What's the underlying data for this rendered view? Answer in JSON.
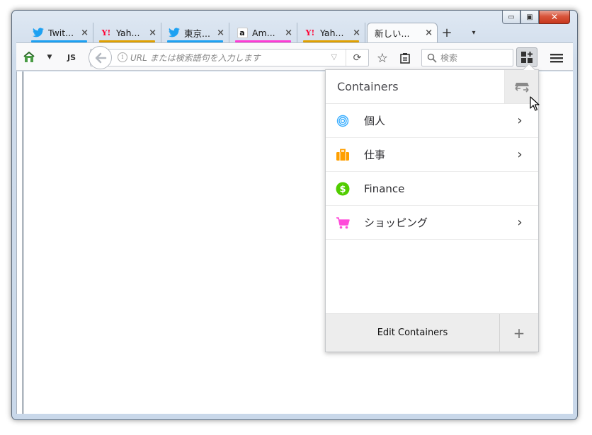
{
  "window": {
    "controls": {
      "minimize": "▭",
      "restore": "▣",
      "close": "✕"
    }
  },
  "tabs": [
    {
      "title": "Twit...",
      "icon": "twitter-icon",
      "accent": "#1da1f2",
      "close": "×"
    },
    {
      "title": "Yah...",
      "icon": "yahoo-icon",
      "accent": "#e0a000",
      "close": "×"
    },
    {
      "title": "東京...",
      "icon": "twitter-icon",
      "accent": "#1da1f2",
      "close": "×"
    },
    {
      "title": "Am...",
      "icon": "amazon-icon",
      "accent": "#ff3bd5",
      "close": "×"
    },
    {
      "title": "Yah...",
      "icon": "yahoo-icon",
      "accent": "#e0a000",
      "close": "×"
    },
    {
      "title": "新しい...",
      "icon": "",
      "accent": "",
      "close": "×",
      "selected": true
    }
  ],
  "tabstrip": {
    "new_tab": "+",
    "list_all": "▾"
  },
  "toolbar": {
    "js_label": "JS",
    "url_placeholder": "URL または検索語句を入力します",
    "search_placeholder": "検索"
  },
  "panel": {
    "title": "Containers",
    "containers": [
      {
        "name": "個人",
        "icon": "fingerprint-icon",
        "color": "#37adff",
        "has_submenu": true
      },
      {
        "name": "仕事",
        "icon": "briefcase-icon",
        "color": "#ff9f00",
        "has_submenu": true
      },
      {
        "name": "Finance",
        "icon": "dollar-icon",
        "color": "#51cd00",
        "has_submenu": false
      },
      {
        "name": "ショッピング",
        "icon": "cart-icon",
        "color": "#ff4bda",
        "has_submenu": true
      }
    ],
    "footer": {
      "edit_label": "Edit Containers",
      "add_label": "+"
    }
  }
}
